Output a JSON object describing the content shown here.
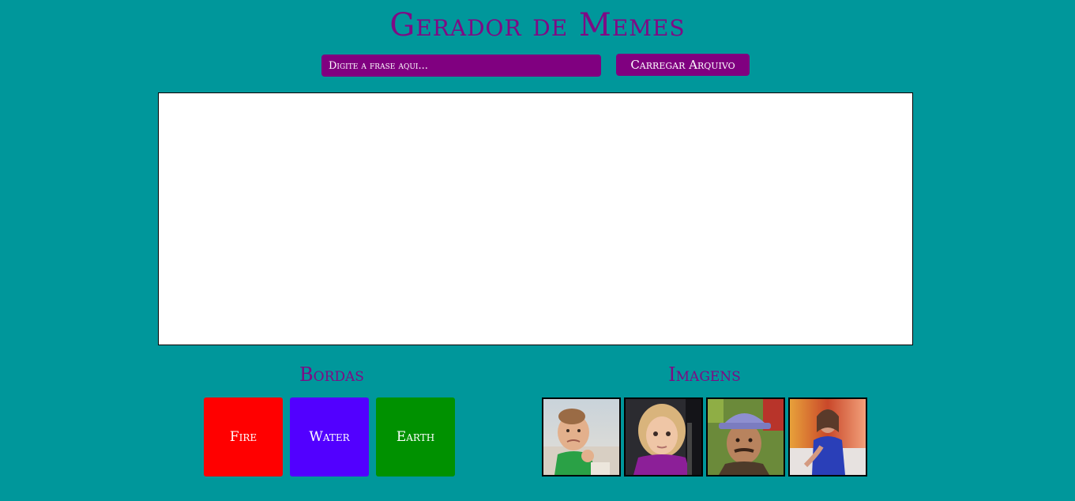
{
  "header": {
    "title": "Gerador de Memes"
  },
  "controls": {
    "text_placeholder": "Digite a frase aqui...",
    "text_value": "",
    "upload_label": "Carregar Arquivo"
  },
  "borders": {
    "title": "Bordas",
    "items": [
      {
        "label": "Fire",
        "color": "#ff0000"
      },
      {
        "label": "Water",
        "color": "#5200ff"
      },
      {
        "label": "Earth",
        "color": "#009100"
      }
    ]
  },
  "images": {
    "title": "Imagens",
    "items": [
      {
        "icon": "success-kid-photo"
      },
      {
        "icon": "side-eye-girl-photo"
      },
      {
        "icon": "seu-madruga-photo"
      },
      {
        "icon": "woman-blue-dress-photo"
      }
    ]
  },
  "colors": {
    "background": "#00979b",
    "accent": "#800080",
    "title": "#7f0a85",
    "canvas": "#ffffff"
  }
}
